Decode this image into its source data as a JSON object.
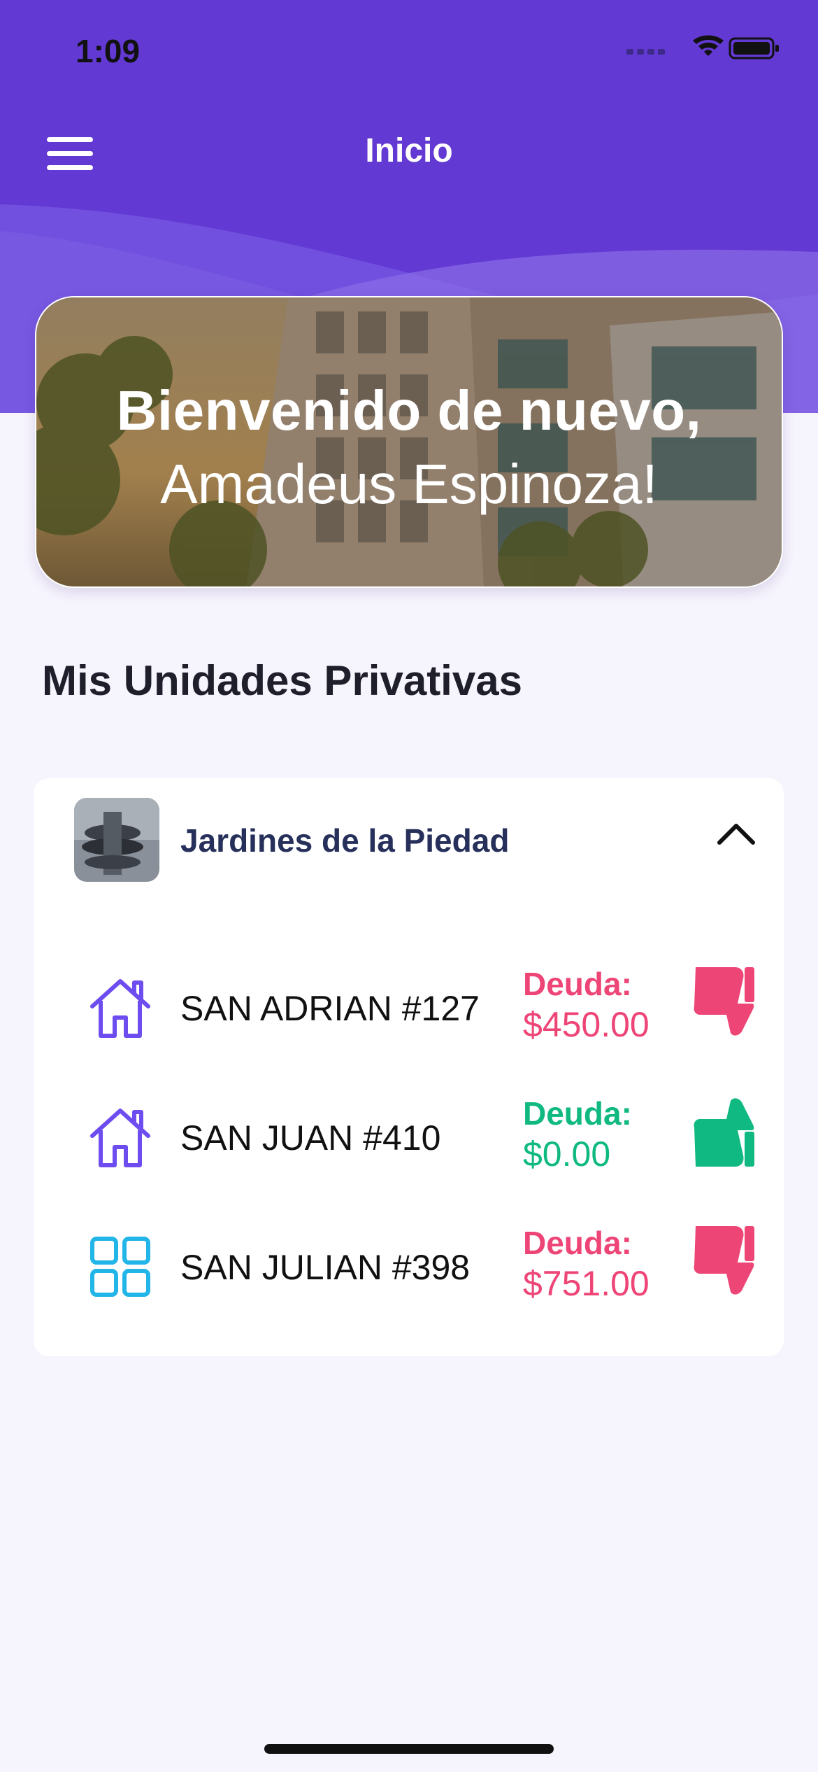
{
  "status_bar": {
    "time": "1:09"
  },
  "nav": {
    "title": "Inicio",
    "menu_icon": "hamburger-menu-icon"
  },
  "banner": {
    "line1": "Bienvenido de nuevo,",
    "line2": "Amadeus Espinoza!"
  },
  "section": {
    "title": "Mis Unidades Privativas"
  },
  "group": {
    "name": "Jardines de la Piedad",
    "expanded": true,
    "units": [
      {
        "name": "SAN ADRIAN #127",
        "icon": "house-icon",
        "debt_label": "Deuda:",
        "debt_amount": "$450.00",
        "status": "owes",
        "status_icon": "thumbs-down-icon"
      },
      {
        "name": "SAN JUAN #410",
        "icon": "house-icon",
        "debt_label": "Deuda:",
        "debt_amount": "$0.00",
        "status": "paid",
        "status_icon": "thumbs-up-icon"
      },
      {
        "name": "SAN JULIAN #398",
        "icon": "grid-icon",
        "debt_label": "Deuda:",
        "debt_amount": "$751.00",
        "status": "owes",
        "status_icon": "thumbs-down-icon"
      }
    ]
  },
  "colors": {
    "header_purple": "#6339d3",
    "debt_red": "#ee4577",
    "paid_green": "#10b981",
    "house_icon": "#6d4cf0",
    "grid_icon": "#22b5e8",
    "title_navy": "#26305a"
  }
}
